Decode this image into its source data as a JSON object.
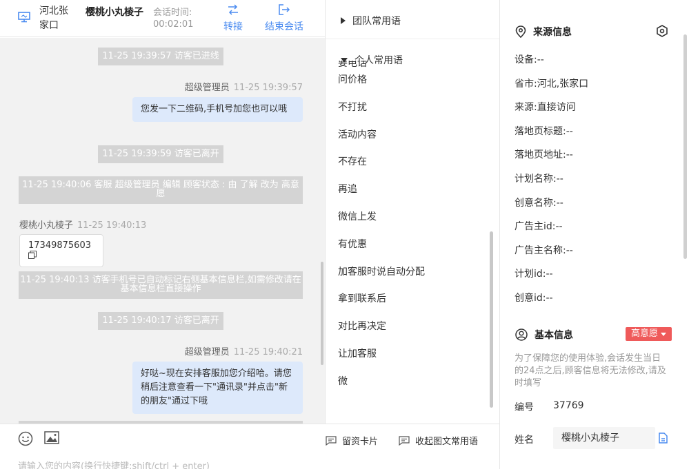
{
  "header": {
    "location": "河北张家口",
    "visitor_name": "樱桃小丸棱子",
    "session_time_label": "会话时间:",
    "session_time": "00:02:01",
    "transfer_label": "转接",
    "end_label": "结束会话"
  },
  "chat": {
    "messages": [
      {
        "kind": "system",
        "text": "11-25 19:39:57 访客已进线"
      },
      {
        "kind": "agent",
        "sender": "超级管理员",
        "time": "11-25 19:39:57",
        "text": "您发一下二维码,手机号加您也可以哦"
      },
      {
        "kind": "system",
        "text": "11-25 19:39:59 访客已离开"
      },
      {
        "kind": "system",
        "text": "11-25 19:40:06 客服 超级管理员 编辑 顾客状态 : 由 了解 改为 高意愿"
      },
      {
        "kind": "visitor",
        "sender": "樱桃小丸棱子",
        "time": "11-25 19:40:13",
        "text": "17349875603"
      },
      {
        "kind": "system",
        "text": "11-25 19:40:13 访客手机号已自动标记右侧基本信息栏,如需修改请在基本信息栏直接操作"
      },
      {
        "kind": "system",
        "text": "11-25 19:40:17 访客已离开"
      },
      {
        "kind": "agent",
        "sender": "超级管理员",
        "time": "11-25 19:40:21",
        "text": "好哒~现在安排客服加您介绍哈。请您稍后注意查看一下\"通讯录\"并点击\"新的朋友\"通过下哦"
      }
    ]
  },
  "input": {
    "placeholder": "请输入您的内容(换行快捷键:shift/ctrl + enter)",
    "card_label": "留资卡片",
    "collapse_label": "收起图文常用语"
  },
  "phrases": {
    "team_group": "团队常用语",
    "personal_group": "个人常用语",
    "partial_item": "要电话",
    "items": [
      "问价格",
      "不打扰",
      "活动内容",
      "不存在",
      "再追",
      "微信上发",
      "有优惠",
      "加客服时说自动分配",
      "拿到联系后",
      "对比再决定",
      "让加客服",
      "微"
    ]
  },
  "source_info": {
    "title": "来源信息",
    "fields": [
      {
        "label": "设备:",
        "value": "--"
      },
      {
        "label": "省市:",
        "value": "河北,张家口"
      },
      {
        "label": "来源:",
        "value": "直接访问"
      },
      {
        "label": "落地页标题:",
        "value": "--"
      },
      {
        "label": "落地页地址:",
        "value": "--"
      },
      {
        "label": "计划名称:",
        "value": "--"
      },
      {
        "label": "创意名称:",
        "value": "--"
      },
      {
        "label": "广告主id:",
        "value": "--"
      },
      {
        "label": "广告主名称:",
        "value": "--"
      },
      {
        "label": "计划id:",
        "value": "--"
      },
      {
        "label": "创意id:",
        "value": "--"
      }
    ]
  },
  "basic_info": {
    "title": "基本信息",
    "status_badge": "高意愿",
    "hint": "为了保障您的使用体验,会话发生当日的24点之后,顾客信息将无法修改,请及时填写",
    "id_label": "编号",
    "id_value": "37769",
    "name_label": "姓名",
    "name_value": "樱桃小丸棱子"
  },
  "colors": {
    "accent": "#4a8bf0",
    "badge": "#ef5a5a",
    "agent_bubble": "#dde9fb",
    "system_bar": "#d4d4d4"
  }
}
